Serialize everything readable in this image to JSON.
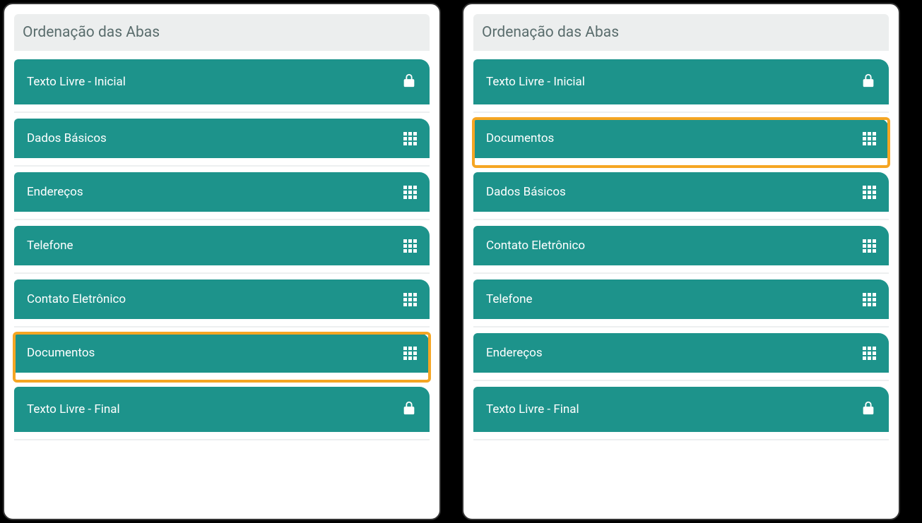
{
  "colors": {
    "accent": "#1d938b",
    "highlight": "#f5a623",
    "headerBg": "#eceeee",
    "headerText": "#5a6d6d"
  },
  "panels": {
    "left": {
      "title": "Ordenação das Abas",
      "items": [
        {
          "label": "Texto Livre - Inicial",
          "icon": "lock",
          "draggable": false,
          "highlighted": false
        },
        {
          "label": "Dados Básicos",
          "icon": "grid",
          "draggable": true,
          "highlighted": false
        },
        {
          "label": "Endereços",
          "icon": "grid",
          "draggable": true,
          "highlighted": false
        },
        {
          "label": "Telefone",
          "icon": "grid",
          "draggable": true,
          "highlighted": false
        },
        {
          "label": "Contato Eletrônico",
          "icon": "grid",
          "draggable": true,
          "highlighted": false
        },
        {
          "label": "Documentos",
          "icon": "grid",
          "draggable": true,
          "highlighted": true
        },
        {
          "label": "Texto Livre - Final",
          "icon": "lock",
          "draggable": false,
          "highlighted": false
        }
      ]
    },
    "right": {
      "title": "Ordenação das Abas",
      "items": [
        {
          "label": "Texto Livre - Inicial",
          "icon": "lock",
          "draggable": false,
          "highlighted": false
        },
        {
          "label": "Documentos",
          "icon": "grid",
          "draggable": true,
          "highlighted": true
        },
        {
          "label": "Dados Básicos",
          "icon": "grid",
          "draggable": true,
          "highlighted": false
        },
        {
          "label": "Contato Eletrônico",
          "icon": "grid",
          "draggable": true,
          "highlighted": false
        },
        {
          "label": "Telefone",
          "icon": "grid",
          "draggable": true,
          "highlighted": false
        },
        {
          "label": "Endereços",
          "icon": "grid",
          "draggable": true,
          "highlighted": false
        },
        {
          "label": "Texto Livre - Final",
          "icon": "lock",
          "draggable": false,
          "highlighted": false
        }
      ]
    }
  }
}
